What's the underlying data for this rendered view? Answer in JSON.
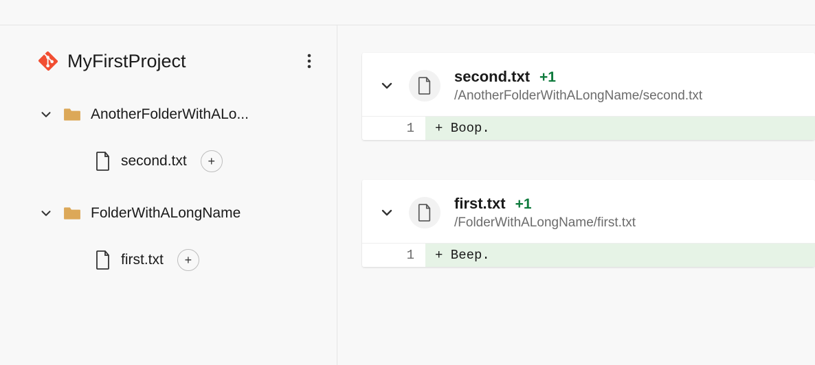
{
  "project": {
    "title": "MyFirstProject"
  },
  "tree": {
    "folders": [
      {
        "label": "AnotherFolderWithALo...",
        "file": {
          "label": "second.txt",
          "badge": "+"
        }
      },
      {
        "label": "FolderWithALongName",
        "file": {
          "label": "first.txt",
          "badge": "+"
        }
      }
    ]
  },
  "diffs": [
    {
      "filename": "second.txt",
      "stat": "+1",
      "path": "/AnotherFolderWithALongName/second.txt",
      "line_no": "1",
      "line_text": "+ Boop."
    },
    {
      "filename": "first.txt",
      "stat": "+1",
      "path": "/FolderWithALongName/first.txt",
      "line_no": "1",
      "line_text": "+ Beep."
    }
  ],
  "colors": {
    "stat_green": "#0e7a3c",
    "added_bg": "#e6f3e6",
    "folder": "#dca858",
    "git": "#f14e32"
  }
}
